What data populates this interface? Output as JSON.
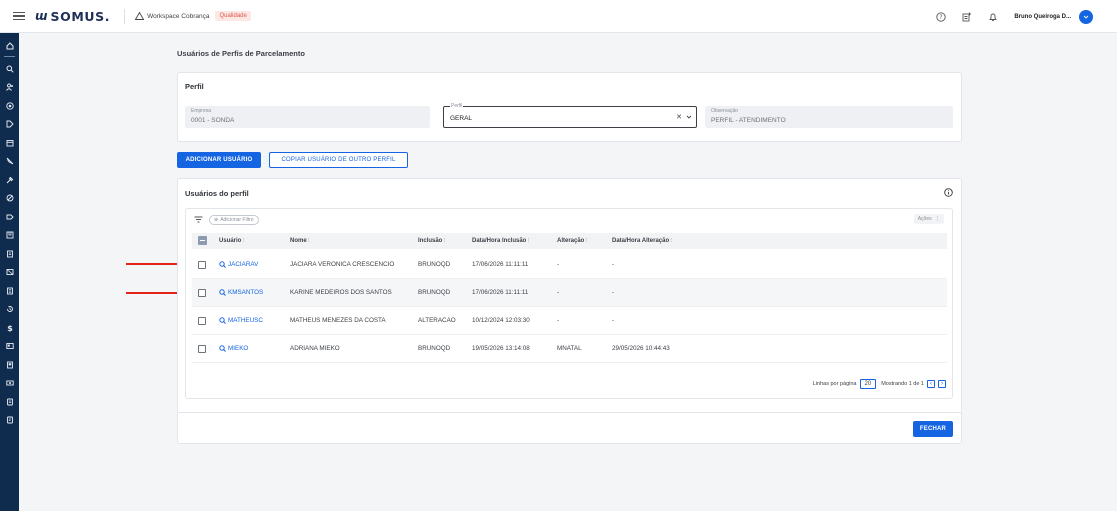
{
  "topbar": {
    "logo": "SOMUS.",
    "workspace": "Workspace Cobrança",
    "environment_tag": "Qualidade",
    "user_name": "Bruno Queiroga D...",
    "icons": [
      "help-icon",
      "apps-icon",
      "bell-icon"
    ]
  },
  "sidebar": {
    "icons": [
      "home-icon",
      "search-icon",
      "people-icon",
      "target-icon",
      "route-icon",
      "calendar-icon",
      "phone-off-icon",
      "tools-icon",
      "block-icon",
      "tag-icon",
      "box-icon",
      "document-icon",
      "layers-icon",
      "list-icon",
      "history-icon",
      "dollar-icon",
      "id-card-icon",
      "file-icon",
      "money-icon",
      "note-icon",
      "note2-icon"
    ]
  },
  "page": {
    "title": "Usuários de Perfis de Parcelamento"
  },
  "perfil": {
    "title": "Perfil",
    "empresa": {
      "label": "Empresa",
      "value": "0001 - SONDA"
    },
    "perfil": {
      "label": "Perfil",
      "value": "GERAL"
    },
    "observacao": {
      "label": "Observação",
      "value": "PERFIL - ATENDIMENTO"
    }
  },
  "actions": {
    "add_user": "ADICIONAR USUÁRIO",
    "copy_user": "COPIAR USUÁRIO DE OUTRO PERFIL"
  },
  "users": {
    "title": "Usuários do perfil",
    "add_filter": "Adicionar Filtro",
    "acoes": "Ações",
    "columns": [
      "Usuário",
      "Nome",
      "Inclusão",
      "Data/Hora Inclusão",
      "Alteração",
      "Data/Hora Alteração"
    ],
    "rows": [
      {
        "usuario": "JACIARAV",
        "nome": "JACIARA VERONICA CRESCENCIO",
        "inclusao": "BRUNOQD",
        "data_inclusao": "17/06/2026 11:11:11",
        "alteracao": "-",
        "data_alteracao": "-",
        "marked": true
      },
      {
        "usuario": "KMSANTOS",
        "nome": "KARINE MEDEIROS DOS SANTOS",
        "inclusao": "BRUNOQD",
        "data_inclusao": "17/06/2026 11:11:11",
        "alteracao": "-",
        "data_alteracao": "-",
        "marked": true
      },
      {
        "usuario": "MATHEUSC",
        "nome": "MATHEUS MENEZES DA COSTA",
        "inclusao": "ALTERACAO",
        "data_inclusao": "10/12/2024 12:03:30",
        "alteracao": "-",
        "data_alteracao": "-",
        "marked": false
      },
      {
        "usuario": "MIEKO",
        "nome": "ADRIANA MIEKO",
        "inclusao": "BRUNOQD",
        "data_inclusao": "19/05/2026 13:14:08",
        "alteracao": "MNATAL",
        "data_alteracao": "29/05/2026 10:44:43",
        "marked": false
      }
    ],
    "pagination": {
      "rows_label": "Linhas por página",
      "rows_per_page": "20",
      "showing": "Mostrando 1 de 1"
    }
  },
  "footer": {
    "close": "FECHAR"
  },
  "colors": {
    "primary": "#1565e3",
    "sidebar": "#0f2c4f",
    "annotation_arrow": "#e3221a",
    "tag": "#e2574c"
  }
}
